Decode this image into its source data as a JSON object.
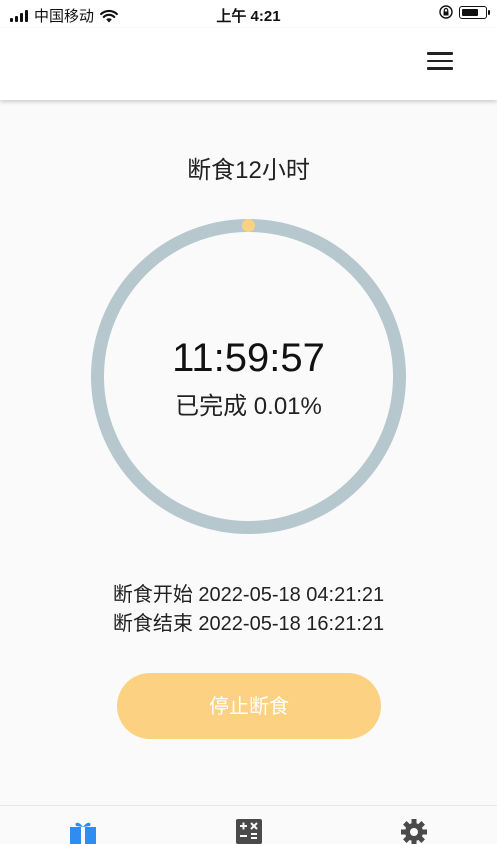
{
  "status_bar": {
    "carrier": "中国移动",
    "time": "上午 4:21"
  },
  "main": {
    "title": "断食12小时",
    "timer": "11:59:57",
    "progress": "已完成 0.01%",
    "progress_fraction": 0.0001,
    "start_line": "断食开始 2022-05-18 04:21:21",
    "end_line": "断食结束 2022-05-18 16:21:21",
    "stop_button_label": "停止断食"
  },
  "tabs": [
    {
      "icon": "gift-icon",
      "active": true
    },
    {
      "icon": "calculator-icon",
      "active": false
    },
    {
      "icon": "gear-icon",
      "active": false
    }
  ],
  "colors": {
    "ring": "#b7c7ce",
    "ring_dot": "#fdd182",
    "button": "#fdd182",
    "active_tab": "#2f8cf0",
    "inactive_tab": "#4a4a4a"
  }
}
